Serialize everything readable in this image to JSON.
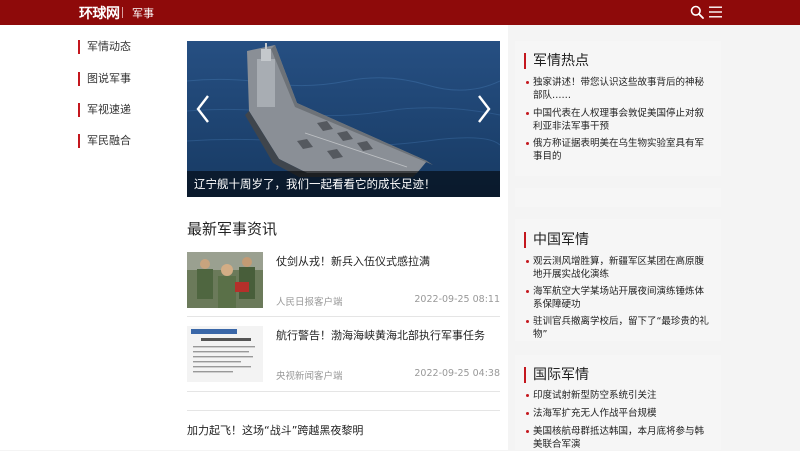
{
  "header": {
    "logo": "环球网",
    "channel": "军事",
    "icons": [
      "search-icon",
      "menu-icon"
    ],
    "bg_color": "#8e0a0a"
  },
  "leftnav": {
    "items": [
      {
        "label": "军情动态"
      },
      {
        "label": "图说军事"
      },
      {
        "label": "军视速递"
      },
      {
        "label": "军民融合"
      }
    ],
    "accent": "#c4171e"
  },
  "hero": {
    "caption": "辽宁舰十周岁了，我们一起看看它的成长足迹！",
    "icons": [
      "chevron-left-icon",
      "chevron-right-icon"
    ]
  },
  "latest": {
    "title": "最新军事资讯",
    "items": [
      {
        "title": "仗剑从戎！新兵入伍仪式感拉满",
        "source": "人民日报客户端",
        "time": "2022-09-25 08:11"
      },
      {
        "title": "航行警告！渤海海峡黄海北部执行军事任务",
        "source": "央视新闻客户端",
        "time": "2022-09-25 04:38"
      }
    ],
    "bottom_title": "加力起飞！这场“战斗”跨越黑夜黎明"
  },
  "panels": {
    "hot": {
      "title": "军情热点",
      "items": [
        "独家讲述！带您认识这些故事背后的神秘部队……",
        "中国代表在人权理事会敦促美国停止对叙利亚非法军事干预",
        "俄方称证据表明美在乌生物实验室具有军事目的"
      ]
    },
    "china": {
      "title": "中国军情",
      "items": [
        "观云测风增胜算，新疆军区某团在高原腹地开展实战化演练",
        "海军航空大学某场站开展夜间演练锤炼体系保障硬功",
        "驻训官兵撤离学校后，留下了“最珍贵的礼物”"
      ]
    },
    "intl": {
      "title": "国际军情",
      "items": [
        "印度试射新型防空系统引关注",
        "法海军扩充无人作战平台规模",
        "美国核航母群抵达韩国，本月底将参与韩美联合军演"
      ]
    }
  }
}
